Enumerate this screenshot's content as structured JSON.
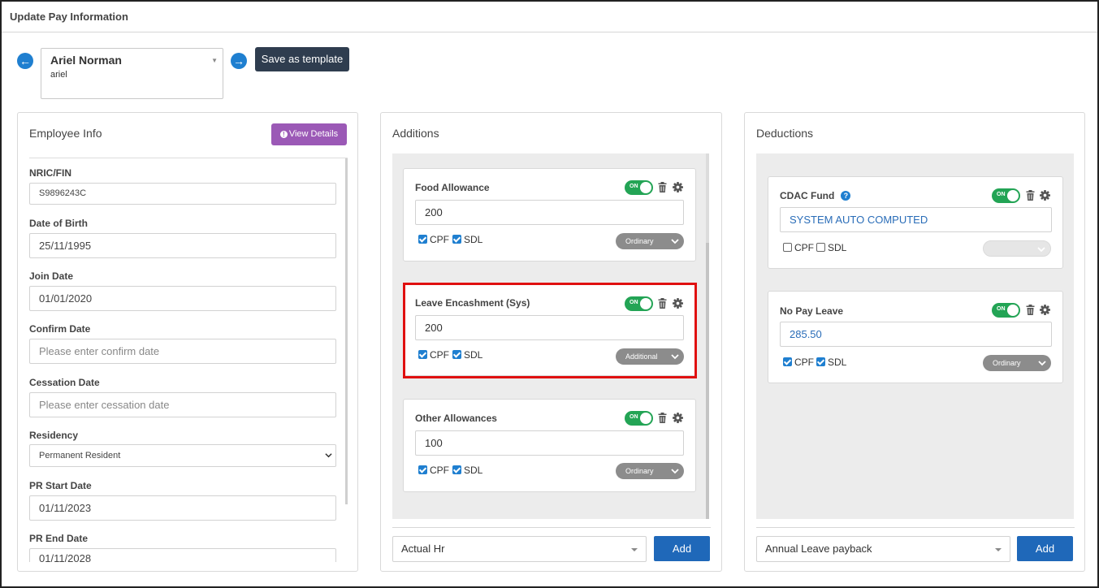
{
  "window": {
    "title": "Update Pay Information"
  },
  "toolbar": {
    "prev_icon": "arrow-left-circle",
    "next_icon": "arrow-right-circle",
    "employee_name": "Ariel Norman",
    "employee_username": "ariel",
    "save_template_label": "Save as template"
  },
  "employee_info": {
    "title": "Employee Info",
    "view_details_label": "View Details",
    "fields": {
      "nric": {
        "label": "NRIC/FIN",
        "value": "S9896243C"
      },
      "dob": {
        "label": "Date of Birth",
        "value": "25/11/1995"
      },
      "join": {
        "label": "Join Date",
        "value": "01/01/2020"
      },
      "confirm": {
        "label": "Confirm Date",
        "placeholder": "Please enter confirm date"
      },
      "cessation": {
        "label": "Cessation Date",
        "placeholder": "Please enter cessation date"
      },
      "residency": {
        "label": "Residency",
        "value": "Permanent Resident"
      },
      "pr_start": {
        "label": "PR Start Date",
        "value": "01/11/2023"
      },
      "pr_end": {
        "label": "PR End Date",
        "value": "01/11/2028"
      }
    }
  },
  "additions": {
    "title": "Additions",
    "items": [
      {
        "name": "Food Allowance",
        "amount": "200",
        "toggle": "ON",
        "cpf_label": "CPF",
        "cpf": true,
        "sdl_label": "SDL",
        "sdl": true,
        "type": "Ordinary"
      },
      {
        "name": "Leave Encashment (Sys)",
        "amount": "200",
        "toggle": "ON",
        "cpf_label": "CPF",
        "cpf": true,
        "sdl_label": "SDL",
        "sdl": true,
        "type": "Additional"
      },
      {
        "name": "Other Allowances",
        "amount": "100",
        "toggle": "ON",
        "cpf_label": "CPF",
        "cpf": true,
        "sdl_label": "SDL",
        "sdl": true,
        "type": "Ordinary"
      }
    ],
    "footer_select": "Actual Hr",
    "add_label": "Add"
  },
  "deductions": {
    "title": "Deductions",
    "items": [
      {
        "name": "CDAC Fund",
        "amount": "SYSTEM AUTO COMPUTED",
        "toggle": "ON",
        "cpf_label": "CPF",
        "cpf": false,
        "sdl_label": "SDL",
        "sdl": false,
        "type": ""
      },
      {
        "name": "No Pay Leave",
        "amount": "285.50",
        "toggle": "ON",
        "cpf_label": "CPF",
        "cpf": true,
        "sdl_label": "SDL",
        "sdl": true,
        "type": "Ordinary"
      }
    ],
    "footer_select": "Annual Leave payback",
    "add_label": "Add"
  },
  "colors": {
    "toggle_on": "#23a455",
    "primary": "#1f68b9",
    "dark_button": "#2f3d4f",
    "view_details": "#9b59b6",
    "highlight": "#e01010"
  }
}
